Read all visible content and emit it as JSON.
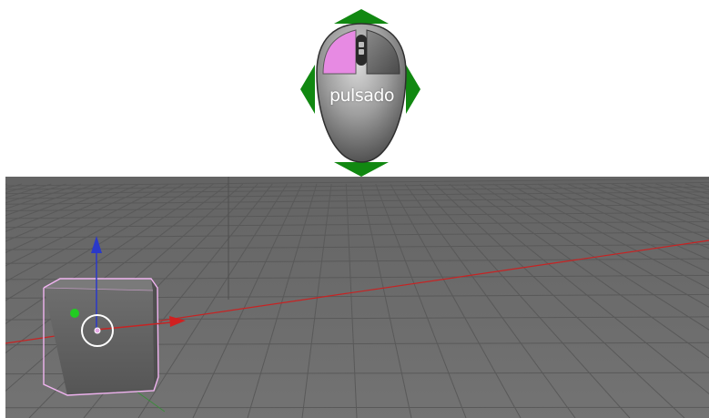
{
  "mouse_indicator": {
    "state_label": "pulsado",
    "pressed_button": "left",
    "arrow_color": "#118811",
    "pressed_color": "#e78ae3",
    "icons": [
      "mouse-icon",
      "arrow-up-icon",
      "arrow-down-icon",
      "arrow-left-icon",
      "arrow-right-icon"
    ]
  },
  "viewport": {
    "background_color": "#6d6d6d",
    "grid_color": "#595959",
    "x_axis_color": "#c72323",
    "selected_outline_color": "#f0b4f0",
    "objects": [
      "cube"
    ],
    "manipulator": [
      "z-axis-arrow",
      "x-axis-arrow",
      "y-axis-handle",
      "3d-cursor"
    ]
  }
}
